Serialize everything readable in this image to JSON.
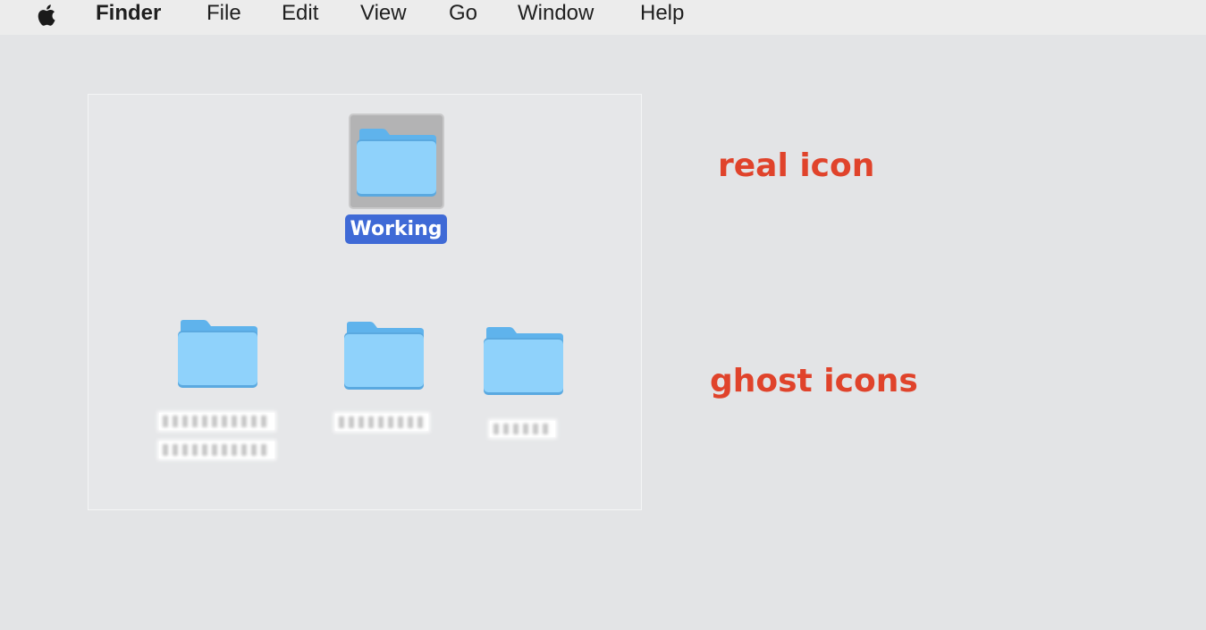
{
  "menubar": {
    "apple_icon": "apple-icon",
    "items": [
      {
        "label": "Finder"
      },
      {
        "label": "File"
      },
      {
        "label": "Edit"
      },
      {
        "label": "View"
      },
      {
        "label": "Go"
      },
      {
        "label": "Window"
      },
      {
        "label": "Help"
      }
    ]
  },
  "desktop": {
    "selected_folder": {
      "label": "Working",
      "icon": "folder-icon",
      "selected": true
    },
    "ghost_folders": [
      {
        "icon": "folder-icon",
        "label_redacted": true
      },
      {
        "icon": "folder-icon",
        "label_redacted": true
      },
      {
        "icon": "folder-icon",
        "label_redacted": true
      }
    ]
  },
  "annotations": {
    "real": "real icon",
    "ghost": "ghost icons"
  },
  "colors": {
    "annotation": "#e0432b",
    "selection_label": "#3f6ad6",
    "folder": "#8fd2fb",
    "desktop": "#e3e4e6"
  }
}
